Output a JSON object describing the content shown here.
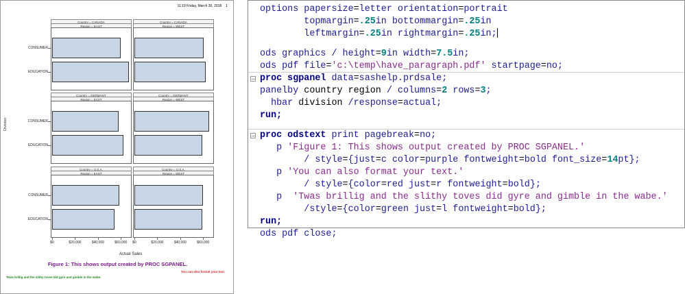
{
  "pdf": {
    "header_time": "11:19 Friday, March 30, 2018",
    "header_page": "1",
    "y_axis_label": "Division",
    "x_axis_label": "Actual Sales",
    "categories": [
      "CONSUMER",
      "EDUCATION"
    ],
    "x_ticks": [
      "$0",
      "$20,000",
      "$40,000",
      "$60,000"
    ],
    "panels": [
      {
        "country": "Country = CANADA",
        "region": "Region = EAST",
        "values": [
          60000,
          67000
        ]
      },
      {
        "country": "Country = CANADA",
        "region": "Region = WEST",
        "values": [
          60500,
          62000
        ]
      },
      {
        "country": "Country = GERMANY",
        "region": "Region = EAST",
        "values": [
          58000,
          62500
        ]
      },
      {
        "country": "Country = GERMANY",
        "region": "Region = WEST",
        "values": [
          65000,
          59500
        ]
      },
      {
        "country": "Country = U.S.A.",
        "region": "Region = EAST",
        "values": [
          58500,
          54500
        ]
      },
      {
        "country": "Country = U.S.A.",
        "region": "Region = WEST",
        "values": [
          60000,
          59500
        ]
      }
    ],
    "fig_title": "Figure 1: This shows output created by PROC SGPANEL.",
    "also_format": "You can also format your text.",
    "brillig": "Twas brillig and the slithy toves did gyre and gimble in the wabe.",
    "colors": {
      "bar_fill": "#c9d6e6",
      "fig_title": "#7b1a8c",
      "also": "#e02020",
      "brillig": "#1f8a1f"
    }
  },
  "chart_data": {
    "type": "bar",
    "orientation": "horizontal",
    "categories": [
      "CONSUMER",
      "EDUCATION"
    ],
    "xlabel": "Actual Sales",
    "ylabel": "Division",
    "xlim": [
      0,
      67000
    ],
    "panels": [
      {
        "country": "CANADA",
        "region": "EAST",
        "values": [
          60000,
          67000
        ]
      },
      {
        "country": "CANADA",
        "region": "WEST",
        "values": [
          60500,
          62000
        ]
      },
      {
        "country": "GERMANY",
        "region": "EAST",
        "values": [
          58000,
          62500
        ]
      },
      {
        "country": "GERMANY",
        "region": "WEST",
        "values": [
          65000,
          59500
        ]
      },
      {
        "country": "U.S.A.",
        "region": "EAST",
        "values": [
          58500,
          54500
        ]
      },
      {
        "country": "U.S.A.",
        "region": "WEST",
        "values": [
          60000,
          59500
        ]
      }
    ]
  },
  "editor": {
    "lines": [
      [
        [
          "ktext",
          "options papersize"
        ],
        [
          "kplain",
          "="
        ],
        [
          "ktext",
          "letter orientation"
        ],
        [
          "kplain",
          "="
        ],
        [
          "ktext",
          "portrait"
        ]
      ],
      [
        [
          "ktext",
          "        topmargin"
        ],
        [
          "kplain",
          "="
        ],
        [
          "knum",
          ".25"
        ],
        [
          "ktext",
          "in bottommargin"
        ],
        [
          "kplain",
          "="
        ],
        [
          "knum",
          ".25"
        ],
        [
          "ktext",
          "in"
        ]
      ],
      [
        [
          "ktext",
          "        leftmargin"
        ],
        [
          "kplain",
          "="
        ],
        [
          "knum",
          ".25"
        ],
        [
          "ktext",
          "in rightmargin"
        ],
        [
          "kplain",
          "="
        ],
        [
          "knum",
          ".25"
        ],
        [
          "ktext",
          "in;"
        ]
      ],
      [],
      [
        [
          "ktext",
          "ods graphics / height"
        ],
        [
          "kplain",
          "="
        ],
        [
          "knum",
          "9"
        ],
        [
          "ktext",
          "in width"
        ],
        [
          "kplain",
          "="
        ],
        [
          "knum",
          "7.5"
        ],
        [
          "ktext",
          "in;"
        ]
      ],
      [
        [
          "ktext",
          "ods pdf file"
        ],
        [
          "kplain",
          "="
        ],
        [
          "kstr",
          "'c:\\temp\\have_paragraph.pdf'"
        ],
        [
          "ktext",
          " startpage"
        ],
        [
          "kplain",
          "="
        ],
        [
          "ktext",
          "no;"
        ]
      ],
      [
        [
          "kbold",
          "proc sgpanel"
        ],
        [
          "ktext",
          " data"
        ],
        [
          "kplain",
          "="
        ],
        [
          "ktext",
          "sashelp.prdsale;"
        ]
      ],
      [
        [
          "ktext",
          "panelby "
        ],
        [
          "kplain",
          "country region"
        ],
        [
          "ktext",
          " / columns"
        ],
        [
          "kplain",
          "="
        ],
        [
          "knum",
          "2"
        ],
        [
          "ktext",
          " rows"
        ],
        [
          "kplain",
          "="
        ],
        [
          "knum",
          "3"
        ],
        [
          "ktext",
          ";"
        ]
      ],
      [
        [
          "ktext",
          "  hbar "
        ],
        [
          "kplain",
          "division"
        ],
        [
          "ktext",
          " /response"
        ],
        [
          "kplain",
          "="
        ],
        [
          "ktext",
          "actual;"
        ]
      ],
      [
        [
          "kbold",
          "run;"
        ]
      ],
      [],
      [
        [
          "kbold",
          "proc odstext"
        ],
        [
          "ktext",
          " print pagebreak"
        ],
        [
          "kplain",
          "="
        ],
        [
          "ktext",
          "no;"
        ]
      ],
      [
        [
          "ktext",
          "   p "
        ],
        [
          "kstr",
          "'Figure 1: This shows output created by PROC SGPANEL.'"
        ]
      ],
      [
        [
          "ktext",
          "        / style"
        ],
        [
          "kplain",
          "="
        ],
        [
          "ktext",
          "{just"
        ],
        [
          "kplain",
          "="
        ],
        [
          "ktext",
          "c color"
        ],
        [
          "kplain",
          "="
        ],
        [
          "ktext",
          "purple fontweight"
        ],
        [
          "kplain",
          "="
        ],
        [
          "ktext",
          "bold font_size"
        ],
        [
          "kplain",
          "="
        ],
        [
          "knum",
          "14"
        ],
        [
          "ktext",
          "pt};"
        ]
      ],
      [
        [
          "ktext",
          "   p "
        ],
        [
          "kstr",
          "'You can also format your text.'"
        ]
      ],
      [
        [
          "ktext",
          "        / style"
        ],
        [
          "kplain",
          "="
        ],
        [
          "ktext",
          "{color"
        ],
        [
          "kplain",
          "="
        ],
        [
          "ktext",
          "red just"
        ],
        [
          "kplain",
          "="
        ],
        [
          "ktext",
          "r fontweight"
        ],
        [
          "kplain",
          "="
        ],
        [
          "ktext",
          "bold};"
        ]
      ],
      [
        [
          "ktext",
          "   p  "
        ],
        [
          "kstr",
          "'Twas brillig and the slithy toves did gyre and gimble in the wabe.'"
        ]
      ],
      [
        [
          "ktext",
          "        /style"
        ],
        [
          "kplain",
          "="
        ],
        [
          "ktext",
          "{color"
        ],
        [
          "kplain",
          "="
        ],
        [
          "ktext",
          "green just"
        ],
        [
          "kplain",
          "="
        ],
        [
          "ktext",
          "l fontweight"
        ],
        [
          "kplain",
          "="
        ],
        [
          "ktext",
          "bold};"
        ]
      ],
      [
        [
          "kbold",
          "run;"
        ]
      ],
      [
        [
          "ktext",
          "ods pdf close;"
        ]
      ]
    ]
  }
}
